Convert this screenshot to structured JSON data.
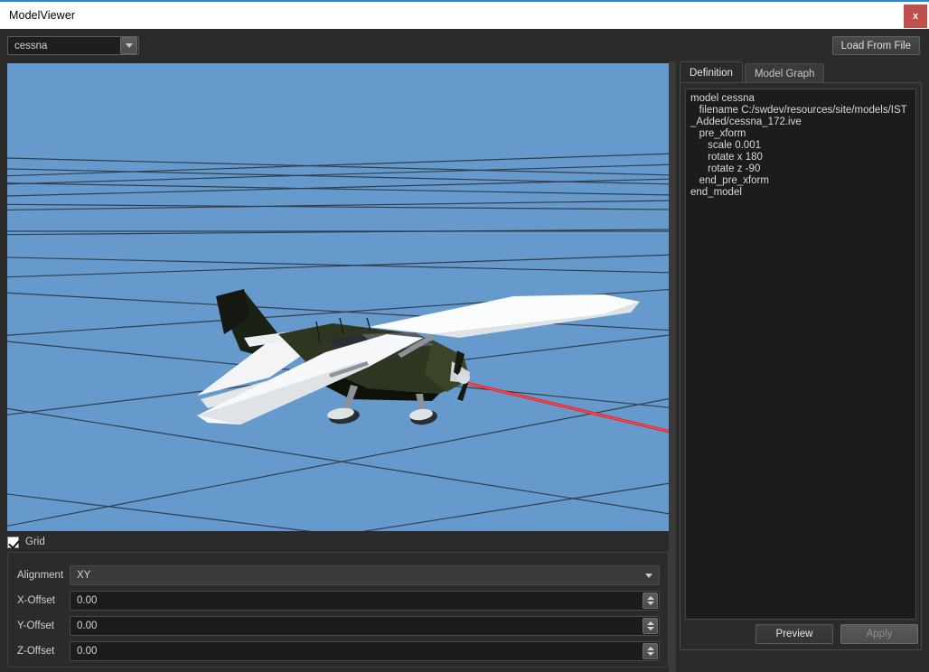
{
  "window": {
    "title": "ModelViewer",
    "close_label": "x"
  },
  "toolbar": {
    "model_combo_value": "cessna",
    "model_combo_arrow_icon": "chevron-down-icon",
    "load_button_label": "Load From File"
  },
  "viewport": {
    "background_color": "#6699cc",
    "grid_line_color": "#2f3a45",
    "model_name": "cessna-172-aircraft",
    "aim_line_color": "#e81c24",
    "body_color": "#2e3622",
    "wing_color": "#f2f4f5"
  },
  "grid_panel": {
    "grid_checkbox_label": "Grid",
    "grid_checked": true,
    "rows": [
      {
        "label": "Alignment",
        "value": "XY",
        "kind": "combo"
      },
      {
        "label": "X-Offset",
        "value": "0.00",
        "kind": "spin"
      },
      {
        "label": "Y-Offset",
        "value": "0.00",
        "kind": "spin"
      },
      {
        "label": "Z-Offset",
        "value": "0.00",
        "kind": "spin"
      }
    ]
  },
  "right_panel": {
    "tabs": [
      {
        "label": "Definition",
        "active": true
      },
      {
        "label": "Model Graph",
        "active": false
      }
    ],
    "definition_text": "model cessna\n   filename C:/swdev/resources/site/models/IST_Added/cessna_172.ive\n   pre_xform\n      scale 0.001\n      rotate x 180\n      rotate z -90\n   end_pre_xform\nend_model",
    "preview_button_label": "Preview",
    "apply_button_label": "Apply",
    "apply_enabled": false
  }
}
